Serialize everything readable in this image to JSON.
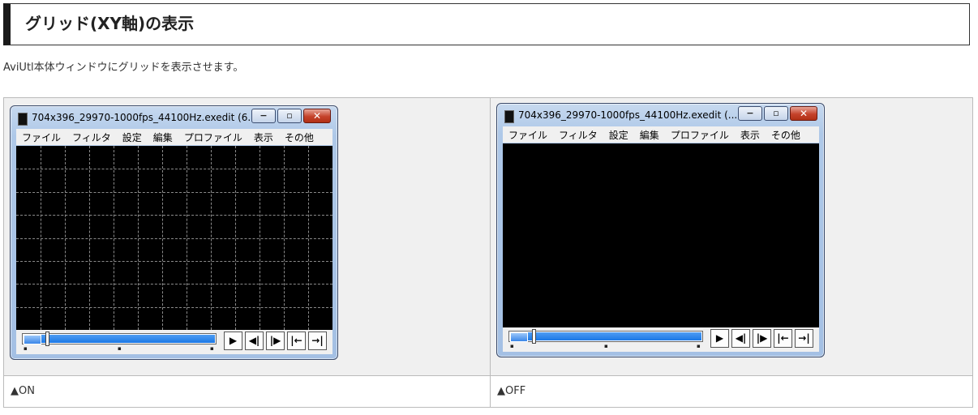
{
  "heading": {
    "title": "グリッド(XY軸)の表示"
  },
  "description": "AviUtl本体ウィンドウにグリッドを表示させます。",
  "comparison": [
    {
      "caption": "▲ON",
      "window": {
        "title": "704x396_29970-1000fps_44100Hz.exedit (6...",
        "grid": true,
        "menu": [
          "ファイル",
          "フィルタ",
          "設定",
          "編集",
          "プロファイル",
          "表示",
          "その他"
        ]
      }
    },
    {
      "caption": "▲OFF",
      "window": {
        "title": "704x396_29970-1000fps_44100Hz.exedit (...",
        "grid": false,
        "menu": [
          "ファイル",
          "フィルタ",
          "設定",
          "編集",
          "プロファイル",
          "表示",
          "その他"
        ]
      }
    }
  ],
  "icons": {
    "minimize": "minimize-icon",
    "maximize": "maximize-icon",
    "close": "close-icon",
    "play": "play-icon",
    "prev_frame": "prev-frame-icon",
    "next_frame": "next-frame-icon",
    "first_frame": "first-frame-icon",
    "last_frame": "last-frame-icon"
  },
  "colors": {
    "seek_bar": "#1b78e6",
    "screen": "#000000",
    "close_button": "#c5422b"
  }
}
